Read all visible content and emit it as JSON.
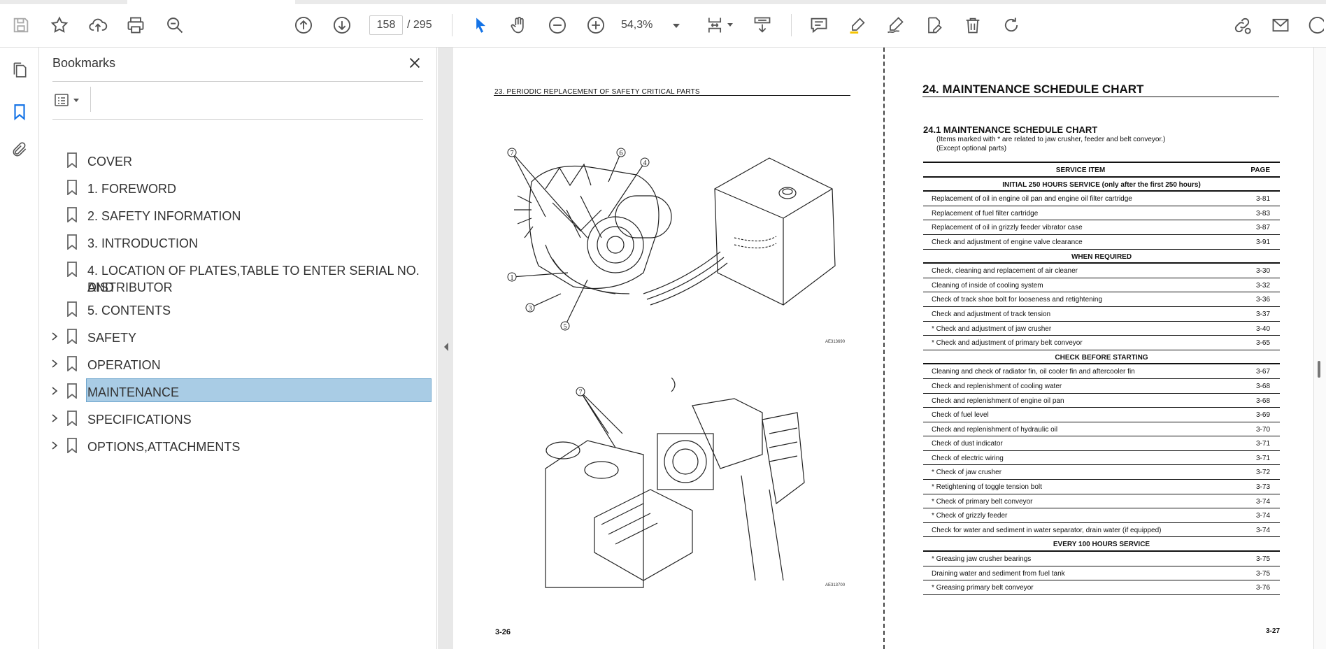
{
  "toolbar": {
    "current_page": "158",
    "page_sep_total": "/  295",
    "zoom": "54,3%"
  },
  "bookmarks": {
    "title": "Bookmarks",
    "items": [
      {
        "label": "COVER",
        "expandable": false
      },
      {
        "label": "1. FOREWORD",
        "expandable": false
      },
      {
        "label": "2. SAFETY INFORMATION",
        "expandable": false
      },
      {
        "label": "3. INTRODUCTION",
        "expandable": false
      },
      {
        "label": "4. LOCATION OF PLATES,TABLE TO ENTER SERIAL NO. AND",
        "label2": "DISTRIBUTOR",
        "expandable": false
      },
      {
        "label": "5. CONTENTS",
        "expandable": false
      },
      {
        "label": "SAFETY",
        "expandable": true
      },
      {
        "label": "OPERATION",
        "expandable": true
      },
      {
        "label": "MAINTENANCE",
        "expandable": true,
        "selected": true
      },
      {
        "label": "SPECIFICATIONS",
        "expandable": true
      },
      {
        "label": "OPTIONS,ATTACHMENTS",
        "expandable": true
      }
    ]
  },
  "left_page": {
    "header": "23.  PERIODIC REPLACEMENT OF SAFETY CRITICAL PARTS",
    "fig1_code": "AE313690",
    "fig2_code": "AE313700",
    "page_number": "3-26",
    "callouts_fig1": [
      "7",
      "6",
      "4",
      "1",
      "3",
      "5"
    ],
    "callouts_fig2": [
      "7"
    ]
  },
  "right_page": {
    "title": "24.  MAINTENANCE SCHEDULE CHART",
    "subtitle": "24.1  MAINTENANCE SCHEDULE CHART",
    "note1": "(Items marked with * are related to jaw crusher, feeder and belt conveyor.)",
    "note2": "(Except optional parts)",
    "page_number": "3-27",
    "table": {
      "col_item": "SERVICE ITEM",
      "col_page": "PAGE",
      "rows": [
        {
          "section": "INITIAL  250 HOURS SERVICE (only after the first 250 hours)"
        },
        {
          "item": "Replacement of oil in engine oil pan and engine oil filter cartridge",
          "page": "3-81"
        },
        {
          "item": "Replacement of fuel filter cartridge",
          "page": "3-83"
        },
        {
          "item": "Replacement of oil in grizzly feeder vibrator case",
          "page": "3-87"
        },
        {
          "item": "Check and adjustment of engine valve clearance",
          "page": "3-91"
        },
        {
          "section": "WHEN REQUIRED"
        },
        {
          "item": "Check, cleaning and replacement of air cleaner",
          "page": "3-30"
        },
        {
          "item": "Cleaning of inside of cooling system",
          "page": "3-32"
        },
        {
          "item": "Check of track shoe bolt for looseness and retightening",
          "page": "3-36"
        },
        {
          "item": "Check and adjustment of track tension",
          "page": "3-37"
        },
        {
          "item": "* Check and adjustment of jaw crusher",
          "page": "3-40"
        },
        {
          "item": "* Check and adjustment of primary belt conveyor",
          "page": "3-65"
        },
        {
          "section": "CHECK BEFORE STARTING"
        },
        {
          "item": "Cleaning and check of radiator fin, oil cooler fin and aftercooler fin",
          "page": "3-67"
        },
        {
          "item": "Check and replenishment of cooling water",
          "page": "3-68"
        },
        {
          "item": "Check and replenishment of engine oil pan",
          "page": "3-68"
        },
        {
          "item": "Check of fuel level",
          "page": "3-69"
        },
        {
          "item": "Check and replenishment of hydraulic oil",
          "page": "3-70"
        },
        {
          "item": "Check of dust indicator",
          "page": "3-71"
        },
        {
          "item": "Check of electric wiring",
          "page": "3-71"
        },
        {
          "item": "* Check of jaw crusher",
          "page": "3-72"
        },
        {
          "item": "* Retightening of toggle tension bolt",
          "page": "3-73"
        },
        {
          "item": "* Check of primary belt conveyor",
          "page": "3-74"
        },
        {
          "item": "* Check of grizzly feeder",
          "page": "3-74"
        },
        {
          "item": "Check for water and sediment in water separator, drain water (if equipped)",
          "page": "3-74"
        },
        {
          "section": "EVERY 100 HOURS SERVICE"
        },
        {
          "item": "* Greasing jaw crusher bearings",
          "page": "3-75"
        },
        {
          "item": "Draining water and sediment from fuel tank",
          "page": "3-75"
        },
        {
          "item": "* Greasing primary belt conveyor",
          "page": "3-76"
        }
      ]
    }
  },
  "colors": {
    "accent_blue": "#1473e6",
    "selection_fill": "#a9cce5",
    "icon_gray": "#555555"
  }
}
